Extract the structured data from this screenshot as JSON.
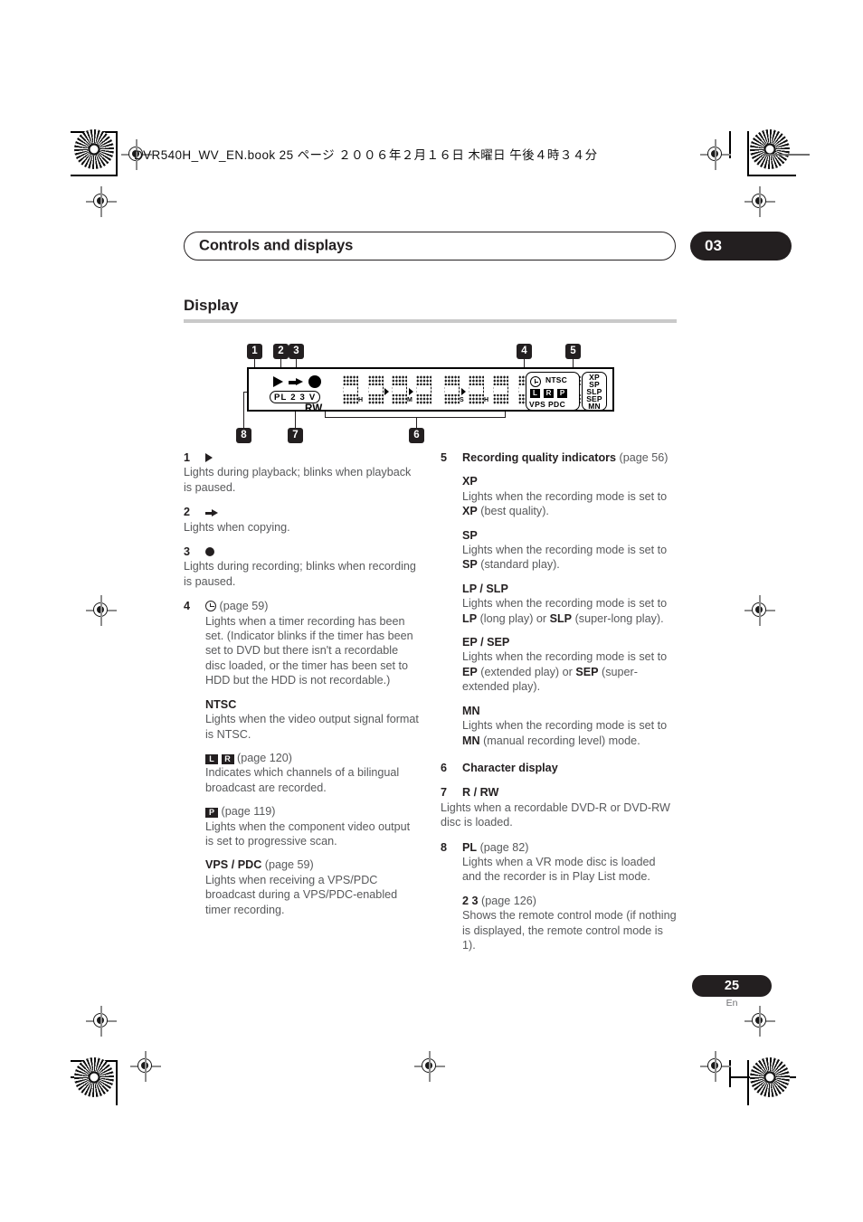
{
  "file_header": {
    "text": "DVR540H_WV_EN.book  25 ページ  ２００６年２月１６日   木曜日   午後４時３４分"
  },
  "running_head": {
    "title": "Controls and displays",
    "chapter": "03"
  },
  "section": {
    "title": "Display"
  },
  "diagram": {
    "name": "front-panel-display-diagram",
    "pl_box": "PL 2 3 V",
    "rw_label": "RW",
    "ntsc_label": "NTSC",
    "lrp": [
      "L",
      "R",
      "P"
    ],
    "vps_pdc_label": "VPS PDC",
    "quality_labels": [
      "XP",
      "SP",
      "SLP",
      "SEP",
      "MN"
    ],
    "char_units": [
      "H",
      "M",
      "S",
      "H",
      "M",
      "S"
    ],
    "callouts": [
      "1",
      "2",
      "3",
      "4",
      "5",
      "6",
      "7",
      "8"
    ]
  },
  "left_column": [
    {
      "num": "1",
      "icon": "play-triangle-icon",
      "head": "",
      "body": "Lights during playback; blinks when playback is paused."
    },
    {
      "num": "2",
      "icon": "copy-arrow-icon",
      "head": "",
      "body": "Lights when copying."
    },
    {
      "num": "3",
      "icon": "record-dot-icon",
      "head": "",
      "body": "Lights during recording; blinks when recording is paused."
    },
    {
      "num": "4",
      "icon": "timer-clock-icon",
      "page_ref": "(page 59)",
      "body": "Lights when a timer recording has been set. (Indicator blinks if the timer has been set to DVD but there isn't a recordable disc loaded, or the timer has been set to HDD but the HDD is not recordable.)"
    }
  ],
  "left_subentries": [
    {
      "title": "NTSC",
      "page_ref": "",
      "body": "Lights when the video output signal format is NTSC."
    },
    {
      "title": "",
      "icons": [
        "L",
        "R"
      ],
      "page_ref": "(page 120)",
      "body": "Indicates which channels of a bilingual broadcast are recorded."
    },
    {
      "title": "",
      "icons": [
        "P"
      ],
      "page_ref": "(page 119)",
      "body": "Lights when the component video output is set to progressive scan."
    },
    {
      "title": "VPS / PDC",
      "page_ref": "(page 59)",
      "body": "Lights when receiving a VPS/PDC broadcast during a VPS/PDC-enabled timer recording."
    }
  ],
  "right_column": {
    "entry5": {
      "num": "5",
      "title": "Recording quality indicators",
      "page_ref": "(page 56)",
      "modes": [
        {
          "title": "XP",
          "body_1": "Lights when the recording mode is set to ",
          "em_1": "XP",
          "body_2": " (best quality)."
        },
        {
          "title": "SP",
          "body_1": "Lights when the recording mode is set to ",
          "em_1": "SP",
          "body_2": " (standard play)."
        },
        {
          "title": "LP / SLP",
          "body_1": "Lights when the recording mode is set to ",
          "em_1": "LP",
          "body_2": " (long play) or ",
          "em_2": "SLP",
          "body_3": " (super-long play)."
        },
        {
          "title": "EP / SEP",
          "body_1": "Lights when the recording mode is set to ",
          "em_1": "EP",
          "body_2": " (extended play) or ",
          "em_2": "SEP",
          "body_3": " (super-extended play)."
        },
        {
          "title": "MN",
          "body_1": "Lights when the recording mode is set to ",
          "em_1": "MN",
          "body_2": " (manual recording level) mode."
        }
      ]
    },
    "entry6": {
      "num": "6",
      "title": "Character display"
    },
    "entry7": {
      "num": "7",
      "title": "R / RW",
      "body": "Lights when a recordable DVD-R or DVD-RW disc is loaded."
    },
    "entry8": {
      "num": "8",
      "title": "PL",
      "page_ref": "(page 82)",
      "body": "Lights when a VR mode disc is loaded and the recorder is in Play List mode.",
      "sub_title": "2 3",
      "sub_page_ref": "(page 126)",
      "sub_body": "Shows the remote control mode (if nothing is displayed, the remote control mode is 1)."
    }
  },
  "footer": {
    "page_number": "25",
    "language": "En"
  },
  "colors": {
    "ink": "#231f20",
    "body_text": "#58595b",
    "rule": "#c9c9c9"
  }
}
